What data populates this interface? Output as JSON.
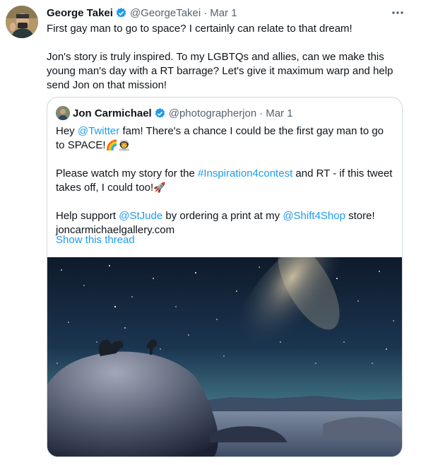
{
  "tweet": {
    "author": {
      "name": "George Takei",
      "handle": "@GeorgeTakei",
      "date": "Mar 1",
      "separator": "·"
    },
    "paragraphs": [
      "First gay man to go to space? I certainly can relate to that dream!",
      "Jon's story is truly inspired. To my LGBTQs and allies, can we make this young man's day with a RT barrage? Let's give it maximum warp and help send Jon on that mission!"
    ],
    "more_icon": "ellipsis-icon"
  },
  "quote": {
    "author": {
      "name": "Jon Carmichael",
      "handle": "@photographerjon",
      "date": "Mar 1",
      "separator": "·"
    },
    "line1": "Hey @Twitter fam! There's a chance I could be the first gay man to go to SPACE!",
    "line1_emoji": "🌈👨‍🚀",
    "para2": "Please watch my story for the #Inspiration4contest and RT - if this tweet takes off, I could too!",
    "para2_emoji": "🚀",
    "para3": "Help support @StJude by ordering a print at my @Shift4Shop store!",
    "url": "joncarmichaelgallery.com",
    "show_thread": "Show this thread"
  },
  "colors": {
    "link": "#1d9bf0",
    "verified": "#1d9bf0",
    "secondary_text": "#536471",
    "border": "#cfd9de"
  }
}
